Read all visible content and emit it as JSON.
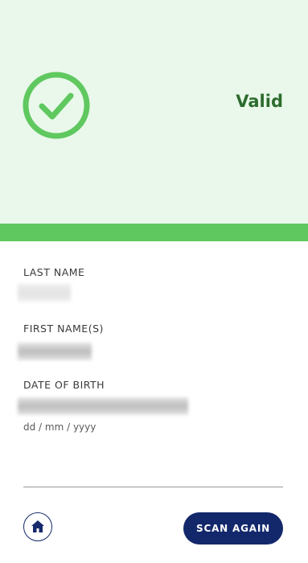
{
  "status": {
    "label": "Valid",
    "icon": "check-circle-icon",
    "panel_color": "#e9f8ea",
    "stripe_color": "#5fc85f",
    "icon_color": "#5fc85f",
    "text_color": "#2d6b2e"
  },
  "fields": {
    "last_name": {
      "label": "LAST NAME"
    },
    "first_names": {
      "label": "FIRST NAME(S)"
    },
    "date_of_birth": {
      "label": "DATE OF BIRTH",
      "format_hint": "dd / mm / yyyy"
    }
  },
  "footer": {
    "home_icon": "home-icon",
    "scan_again_label": "SCAN AGAIN",
    "button_color": "#13286b"
  }
}
